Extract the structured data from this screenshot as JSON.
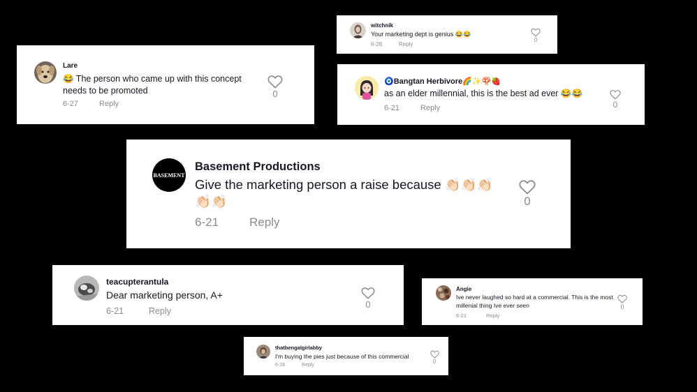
{
  "comments": [
    {
      "username": "witchnik",
      "text": "Your marketing dept is genius 😂😂",
      "date": "6-28",
      "reply_label": "Reply",
      "likes": "0",
      "avatar_icon": "user-avatar-woman",
      "avatar_color": "#6b5a50"
    },
    {
      "username": "Lare",
      "text": "😂 The person who came up with this concept needs to be promoted",
      "date": "6-27",
      "reply_label": "Reply",
      "likes": "0",
      "avatar_icon": "dog-avatar",
      "avatar_color": "#c7b294"
    },
    {
      "username": "🧿Bangtan Herbivore🌈✨🍄🍓",
      "text": "as an elder millennial, this is the best ad ever 😂😂",
      "date": "6-21",
      "reply_label": "Reply",
      "likes": "0",
      "avatar_icon": "cartoon-girl-avatar",
      "avatar_color": "#fbe9a6"
    },
    {
      "username": "Basement Productions",
      "text": "Give the marketing person a raise because 👏🏻👏🏻👏🏻👏🏻👏🏻",
      "date": "6-21",
      "reply_label": "Reply",
      "likes": "0",
      "avatar_icon": "basement-logo-avatar",
      "avatar_logo_text": "BASEMENT",
      "avatar_color": "#000000"
    },
    {
      "username": "teacupterantula",
      "text": "Dear marketing person, A+",
      "date": "6-21",
      "reply_label": "Reply",
      "likes": "0",
      "avatar_icon": "user-avatar-photo",
      "avatar_color": "#8c8c8c"
    },
    {
      "username": "Angie",
      "text": "Ive never laughed so hard at a commercial. This is the most millenial thing Ive ever seen",
      "date": "6-21",
      "reply_label": "Reply",
      "likes": "0",
      "avatar_icon": "user-avatar-photo",
      "avatar_color": "#6a4a3a"
    },
    {
      "username": "thatbengalgirlabby",
      "text": "I'm buying the pies just because of this commercial",
      "date": "6-28",
      "reply_label": "Reply",
      "likes": "0",
      "avatar_icon": "user-avatar-photo",
      "avatar_color": "#7a6a5a"
    }
  ]
}
